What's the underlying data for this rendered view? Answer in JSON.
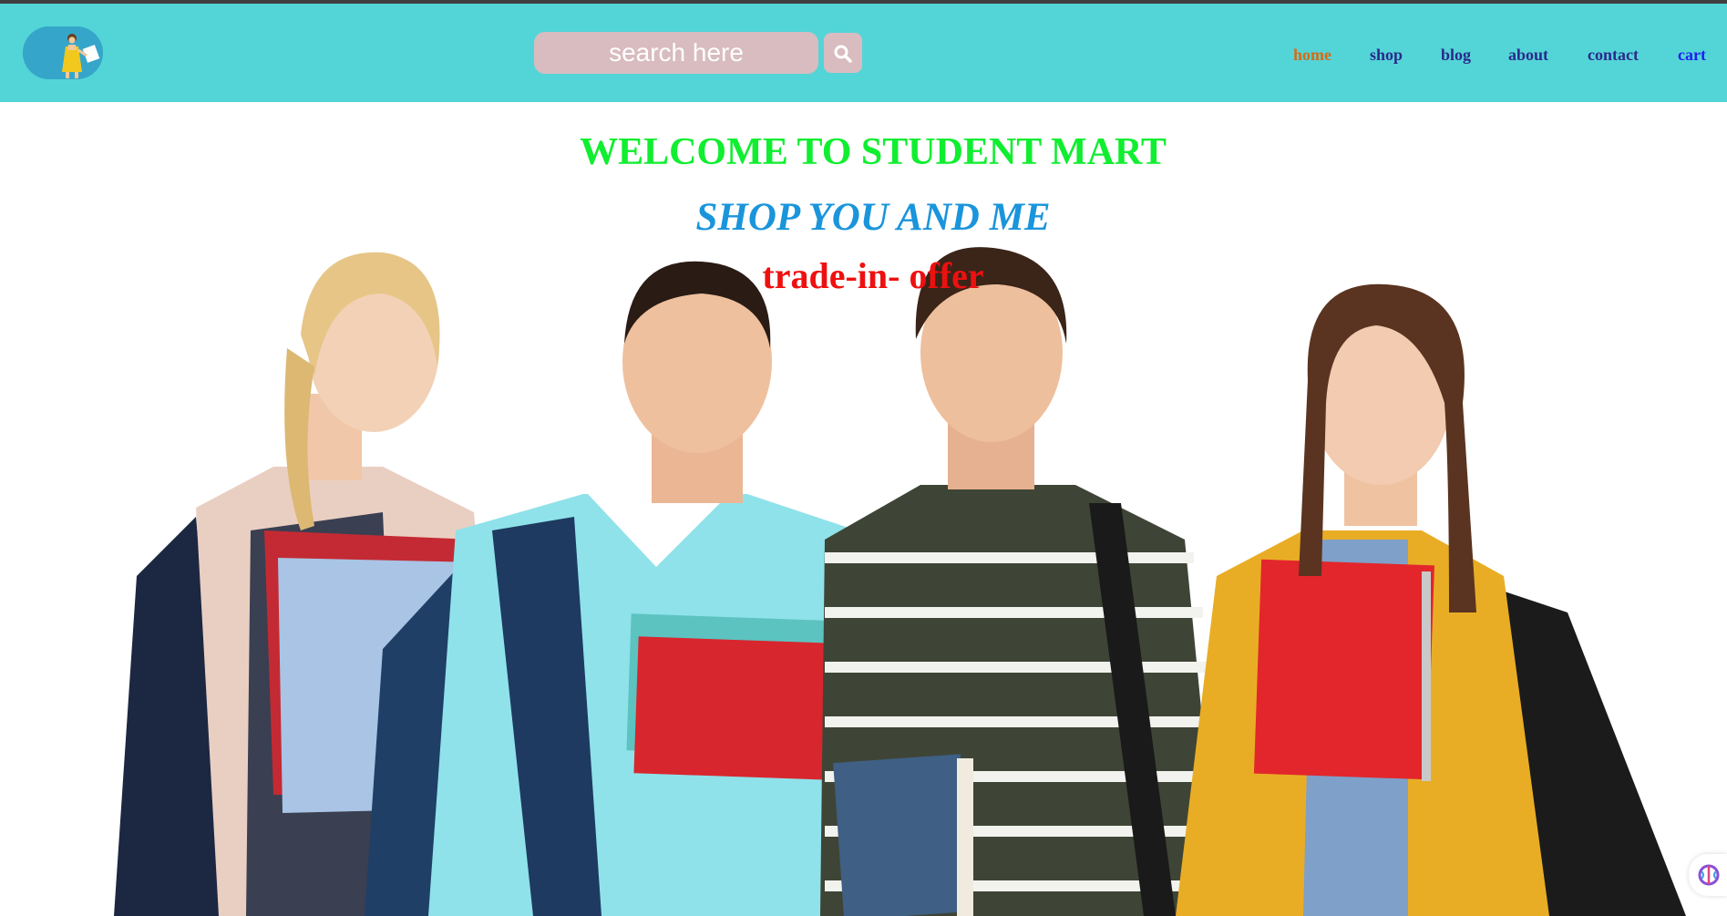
{
  "header": {
    "logo_alt": "shopping girl logo",
    "search": {
      "placeholder": "search here",
      "icon": "search-icon"
    },
    "nav": [
      {
        "label": "home",
        "active": true
      },
      {
        "label": "shop"
      },
      {
        "label": "blog"
      },
      {
        "label": "about"
      },
      {
        "label": "contact"
      },
      {
        "label": "cart"
      }
    ]
  },
  "hero": {
    "title": "WELCOME TO STUDENT MART",
    "subtitle": "SHOP YOU AND ME",
    "offer": "trade-in- offer"
  },
  "colors": {
    "header_bg": "#53d5d8",
    "search_bg": "#d8bcc0",
    "title": "#10ee30",
    "subtitle": "#1a95db",
    "offer": "#ee1010",
    "nav_active": "#d86a12",
    "nav": "#2a2a8a",
    "cart": "#1e20ee"
  }
}
